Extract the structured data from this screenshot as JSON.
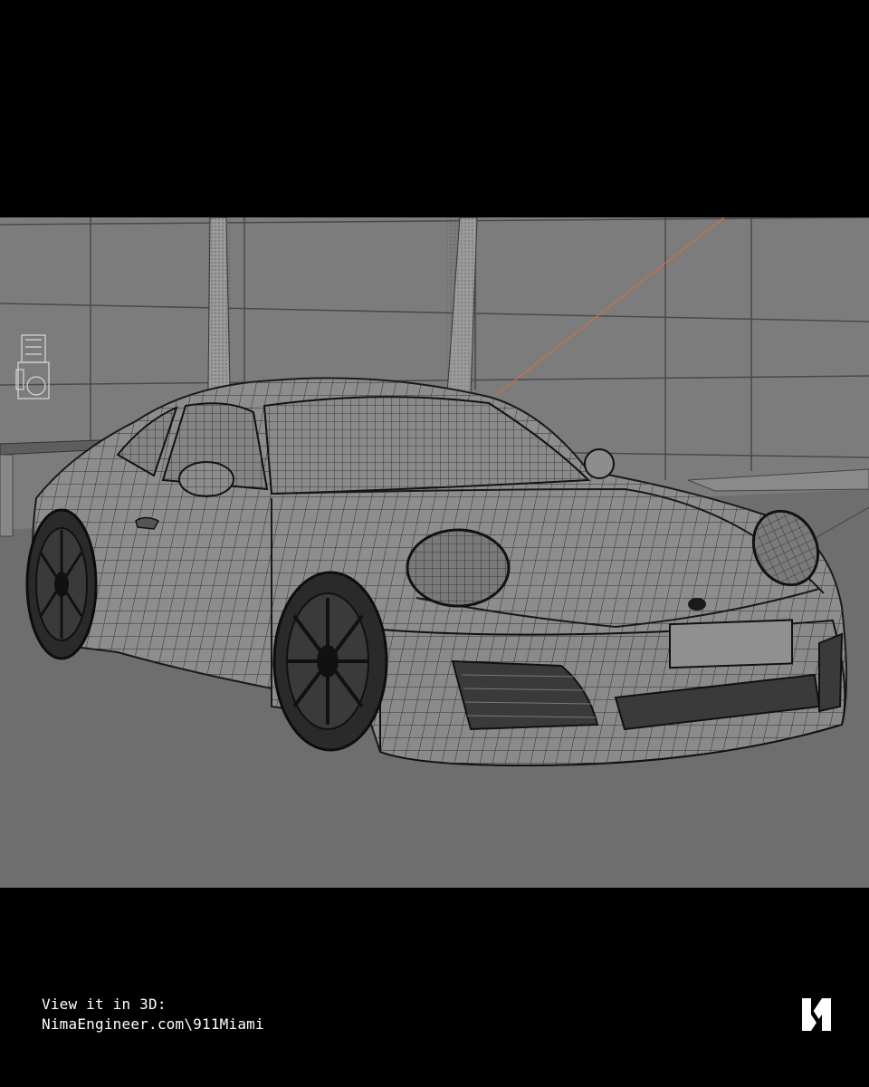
{
  "caption": {
    "line1": "View it in 3D:",
    "line2": "NimaEngineer.com\\911Miami"
  },
  "logo": {
    "icon": "n-logo-icon",
    "color": "#ffffff"
  },
  "viewport": {
    "background_color": "#7c7c7c",
    "floor_color": "#6e6e6e",
    "wire_color": "#2a2a2a",
    "light_line_color": "#d0703a"
  }
}
